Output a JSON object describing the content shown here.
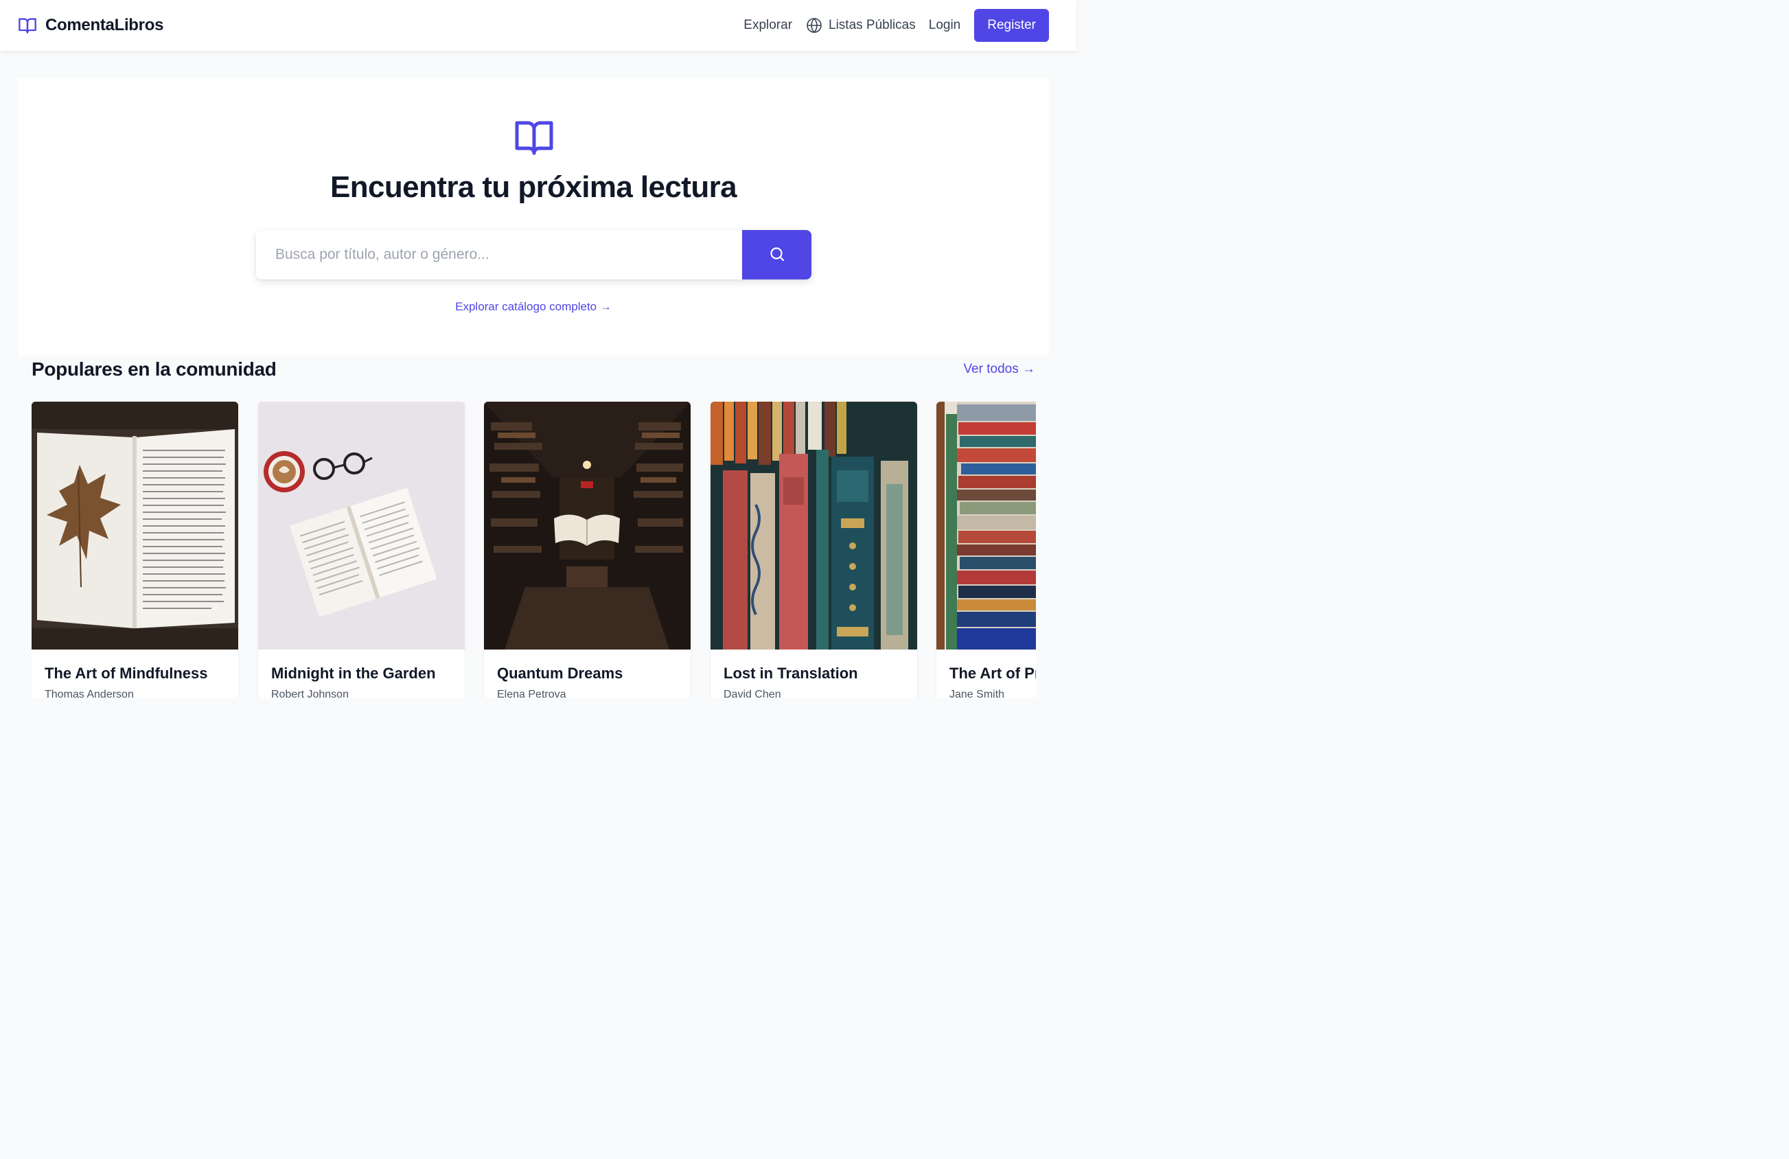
{
  "header": {
    "brand": "ComentaLibros",
    "nav": {
      "explore": "Explorar",
      "lists": "Listas Públicas",
      "login": "Login",
      "register": "Register"
    }
  },
  "hero": {
    "title": "Encuentra tu próxima lectura",
    "search_placeholder": "Busca por título, autor o género...",
    "search_value": "",
    "explore_link": "Explorar catálogo completo →"
  },
  "popular": {
    "title": "Populares en la comunidad",
    "see_all": "Ver todos →",
    "books": [
      {
        "title": "The Art of Mindfulness",
        "author": "Thomas Anderson",
        "image": "open-book-with-autumn-leaf"
      },
      {
        "title": "Midnight in the Garden",
        "author": "Robert Johnson",
        "image": "open-book-coffee-glasses"
      },
      {
        "title": "Quantum Dreams",
        "author": "Elena Petrova",
        "image": "floating-book-in-library"
      },
      {
        "title": "Lost in Translation",
        "author": "David Chen",
        "image": "antique-book-spines"
      },
      {
        "title": "The Art of Pr",
        "author": "Jane Smith",
        "image": "stacked-colorful-books"
      }
    ]
  },
  "colors": {
    "accent": "#4f46e5",
    "text": "#111827",
    "muted": "#4b5563",
    "background": "#f9fafb"
  }
}
